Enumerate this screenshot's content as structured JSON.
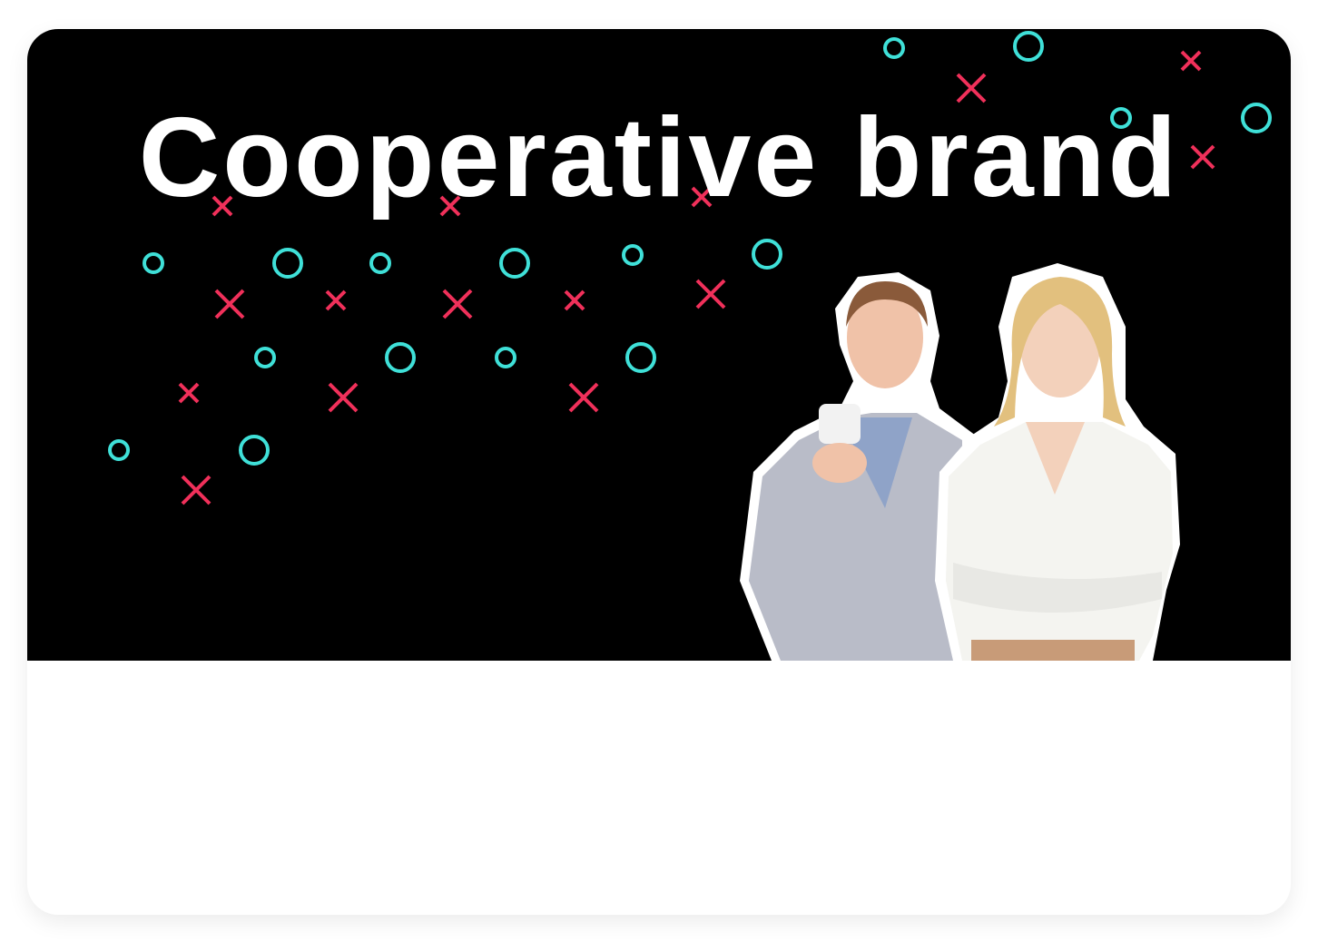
{
  "banner": {
    "title": "Cooperative brand",
    "background_color": "#000000",
    "accent_circle_color": "#3fe0d8",
    "accent_cross_color": "#f0305a"
  }
}
